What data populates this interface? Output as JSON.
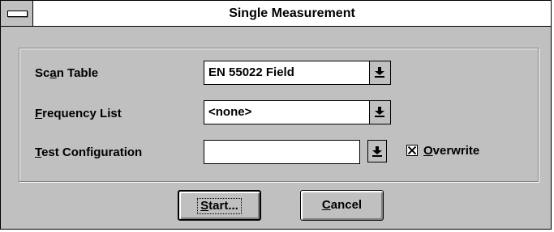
{
  "window": {
    "title": "Single Measurement"
  },
  "form": {
    "scan_table": {
      "label_pre": "Sc",
      "label_key": "a",
      "label_post": "n Table",
      "value": "EN 55022 Field"
    },
    "frequency_list": {
      "label_key": "F",
      "label_post": "requency List",
      "value": "<none>"
    },
    "test_configuration": {
      "label_key": "T",
      "label_post": "est Configuration",
      "value": ""
    },
    "overwrite": {
      "label_key": "O",
      "label_post": "verwrite",
      "checked": true
    }
  },
  "buttons": {
    "start": {
      "label_key": "S",
      "label_post": "tart..."
    },
    "cancel": {
      "label_key": "C",
      "label_post": "ancel"
    }
  },
  "icons": {
    "system_menu": "system-menu-icon",
    "dropdown": "dropdown-arrow-icon",
    "checkmark": "checkbox-x-icon"
  }
}
